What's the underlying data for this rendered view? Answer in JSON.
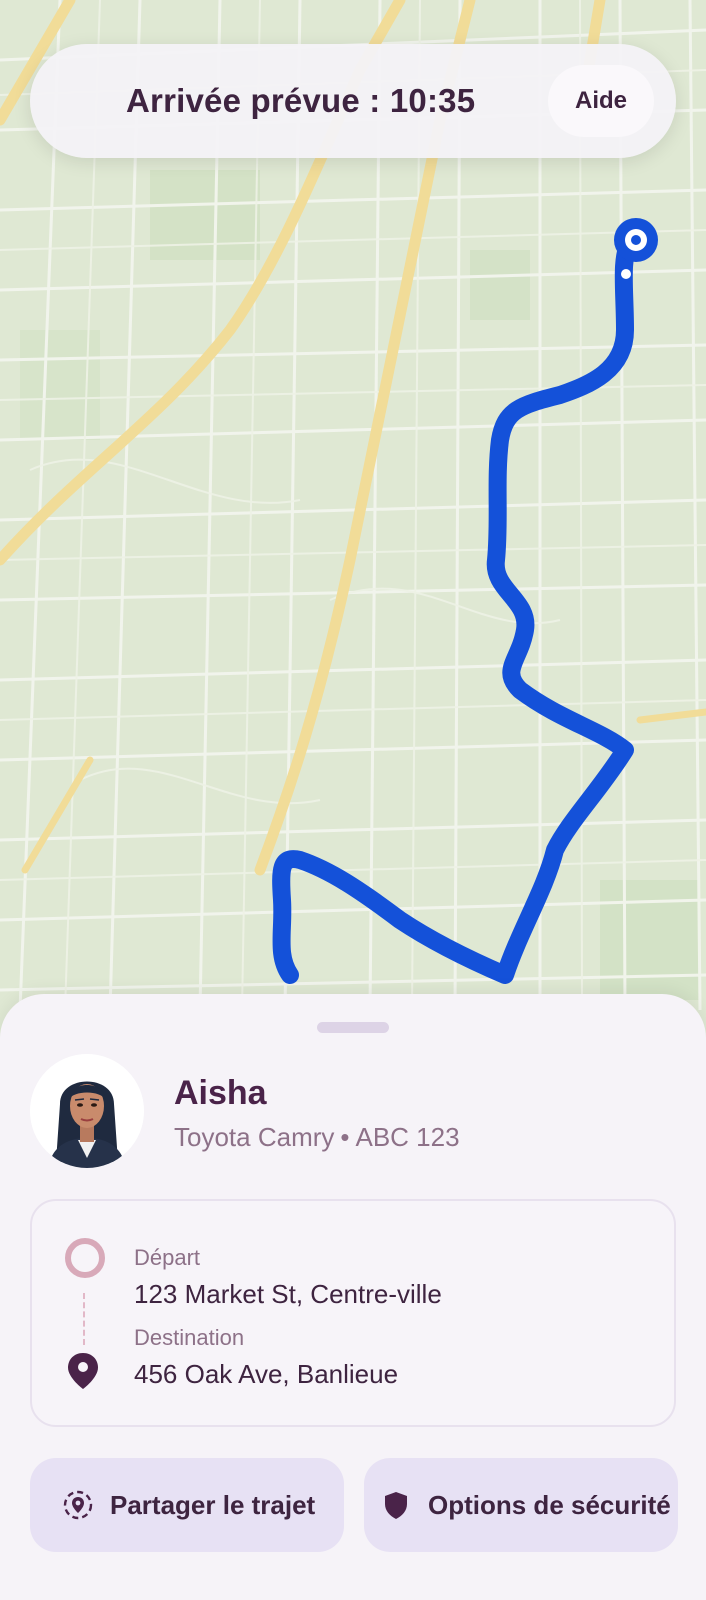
{
  "header": {
    "eta_text": "Arrivée prévue : 10:35",
    "help_label": "Aide"
  },
  "map": {
    "route_color": "#1451d9",
    "background_color": "#dfe8d3"
  },
  "driver": {
    "name": "Aisha",
    "car_model": "Toyota Camry",
    "separator": "•",
    "plate": "ABC 123"
  },
  "trip": {
    "departure_label": "Départ",
    "departure_address": "123 Market St, Centre-ville",
    "destination_label": "Destination",
    "destination_address": "456 Oak Ave, Banlieue"
  },
  "actions": {
    "share_label": "Partager le trajet",
    "share_icon": "share-location-icon",
    "safety_label": "Options de sécurité",
    "safety_icon": "shield-icon"
  },
  "colors": {
    "accent_dark": "#4a2349",
    "button_bg": "#e7e1f4",
    "origin_ring": "#d8a9b9"
  }
}
